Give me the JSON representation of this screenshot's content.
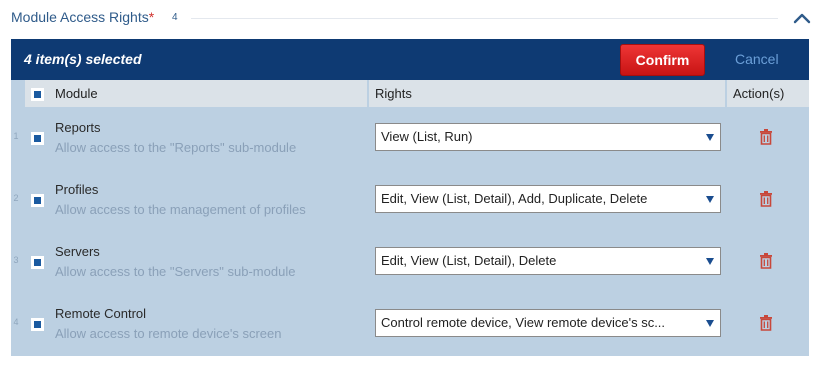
{
  "section": {
    "title": "Module Access Rights",
    "required_mark": "*",
    "count": "4"
  },
  "toolbar": {
    "selected_text": "4 item(s) selected",
    "confirm_label": "Confirm",
    "cancel_label": "Cancel"
  },
  "grid": {
    "headers": {
      "module": "Module",
      "rights": "Rights",
      "actions": "Action(s)"
    },
    "rows": [
      {
        "num": "1",
        "title": "Reports",
        "desc": "Allow access to the \"Reports\" sub-module",
        "rights": "View (List, Run)"
      },
      {
        "num": "2",
        "title": "Profiles",
        "desc": "Allow access to the management of profiles",
        "rights": "Edit, View (List, Detail), Add, Duplicate, Delete"
      },
      {
        "num": "3",
        "title": "Servers",
        "desc": "Allow access to the \"Servers\" sub-module",
        "rights": "Edit, View (List, Detail), Delete"
      },
      {
        "num": "4",
        "title": "Remote Control",
        "desc": "Allow access to remote device's screen",
        "rights": "Control remote device, View remote device's sc..."
      }
    ]
  },
  "colors": {
    "toolbar_bg": "#0e3a73",
    "grid_bg": "#bcd0e2",
    "confirm_bg": "#d92020",
    "trash_icon": "#c8473a",
    "title_text": "#2f5b8a"
  },
  "icons": {
    "collapse": "chevron-up-icon",
    "delete": "trash-icon",
    "dropdown": "caret-down-icon"
  }
}
